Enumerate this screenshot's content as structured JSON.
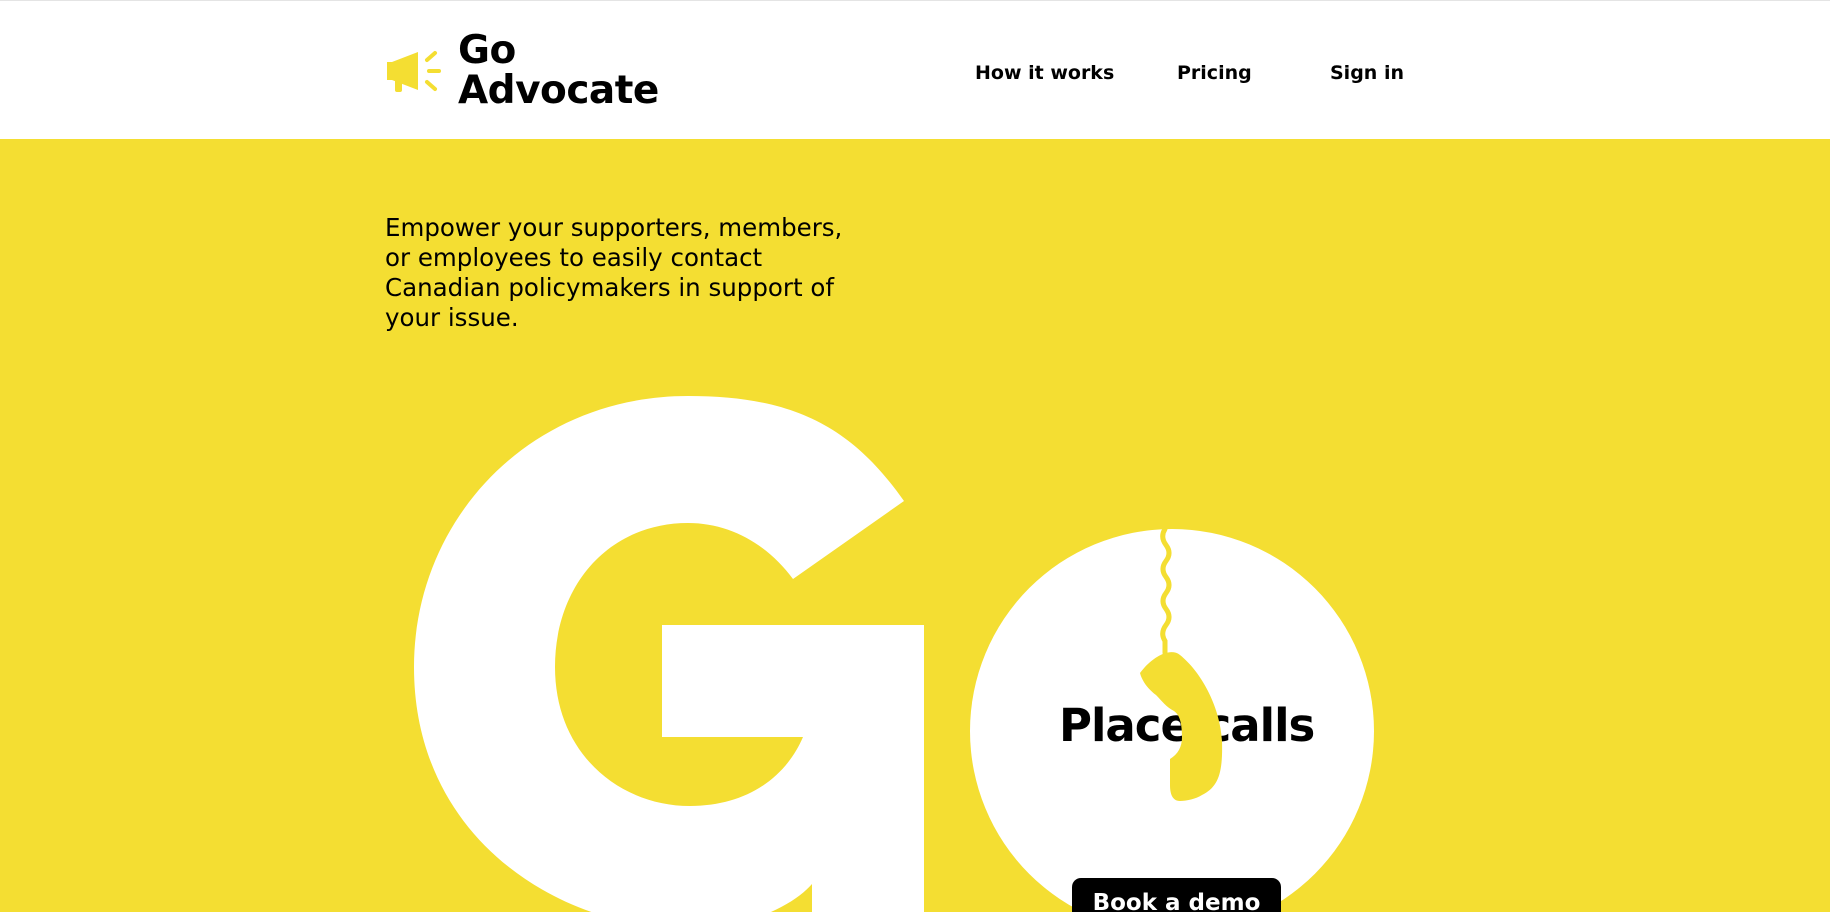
{
  "header": {
    "logo_line1": "Go",
    "logo_line2": "Advocate",
    "logo_icon": "megaphone-icon",
    "nav": {
      "how_it_works": "How it works",
      "pricing": "Pricing",
      "sign_in": "Sign in"
    }
  },
  "hero": {
    "tagline": "Empower your supporters, members, or employees to easily contact Canadian policymakers in support of your issue.",
    "big_letter": "G",
    "circle_heading": "Place calls",
    "circle_icon": "phone-handset-icon",
    "cta_label": "Book a demo"
  },
  "colors": {
    "brand_yellow": "#f4de32",
    "text": "#000000",
    "white": "#ffffff"
  }
}
